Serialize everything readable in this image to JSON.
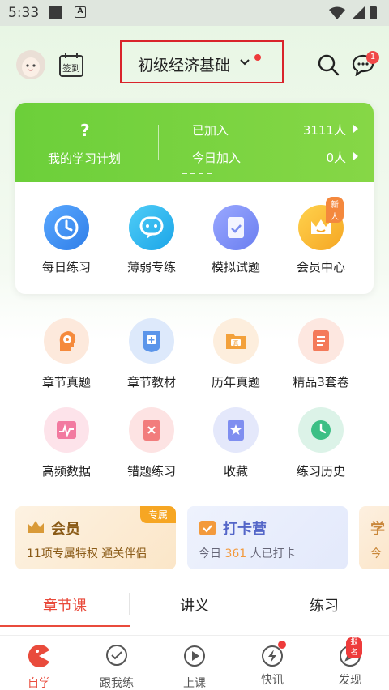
{
  "status_bar": {
    "time": "5:33"
  },
  "header": {
    "checkin_label": "签到",
    "exam_title": "初级经济基础",
    "message_count": "1"
  },
  "plan": {
    "question_mark": "?",
    "label": "我的学习计划",
    "joined_label": "已加入",
    "joined_value": "3111人",
    "today_label": "今日加入",
    "today_value": "0人"
  },
  "quick_actions": [
    {
      "label": "每日练习",
      "icon": "clock-icon",
      "color": "#3d8ef0"
    },
    {
      "label": "薄弱专练",
      "icon": "chat-bubble-icon",
      "color": "#2ab5f0"
    },
    {
      "label": "模拟试题",
      "icon": "exam-paper-icon",
      "color": "#7b8ff0"
    },
    {
      "label": "会员中心",
      "icon": "crown-icon",
      "color": "#f5a623",
      "badge": "新人"
    }
  ],
  "grid": [
    {
      "label": "章节真题",
      "icon": "gear-head-icon"
    },
    {
      "label": "章节教材",
      "icon": "book-plus-icon"
    },
    {
      "label": "历年真题",
      "icon": "folder-icon"
    },
    {
      "label": "精品3套卷",
      "icon": "checklist-icon"
    },
    {
      "label": "高频数据",
      "icon": "pulse-chart-icon"
    },
    {
      "label": "错题练习",
      "icon": "wrong-doc-icon"
    },
    {
      "label": "收藏",
      "icon": "star-doc-icon"
    },
    {
      "label": "练习历史",
      "icon": "history-clock-icon"
    }
  ],
  "promos": {
    "member": {
      "title": "会员",
      "subtitle": "11项专属特权  通关伴侣",
      "tag": "专属"
    },
    "camp": {
      "title": "打卡营",
      "subtitle_prefix": "今日 ",
      "count": "361",
      "subtitle_suffix": " 人已打卡"
    },
    "third": {
      "title": "学",
      "subtitle": "今"
    }
  },
  "tabs": [
    "章节课",
    "讲义",
    "练习"
  ],
  "bottom_nav": [
    {
      "label": "自学",
      "icon": "pacman-icon"
    },
    {
      "label": "跟我练",
      "icon": "check-bubble-icon"
    },
    {
      "label": "上课",
      "icon": "play-circle-icon"
    },
    {
      "label": "快讯",
      "icon": "lightning-icon"
    },
    {
      "label": "发现",
      "icon": "compass-icon",
      "badge": "报名"
    }
  ],
  "colors": {
    "accent": "#e94b3c",
    "green": "#6ccf3a",
    "outline": "#d9242b"
  }
}
